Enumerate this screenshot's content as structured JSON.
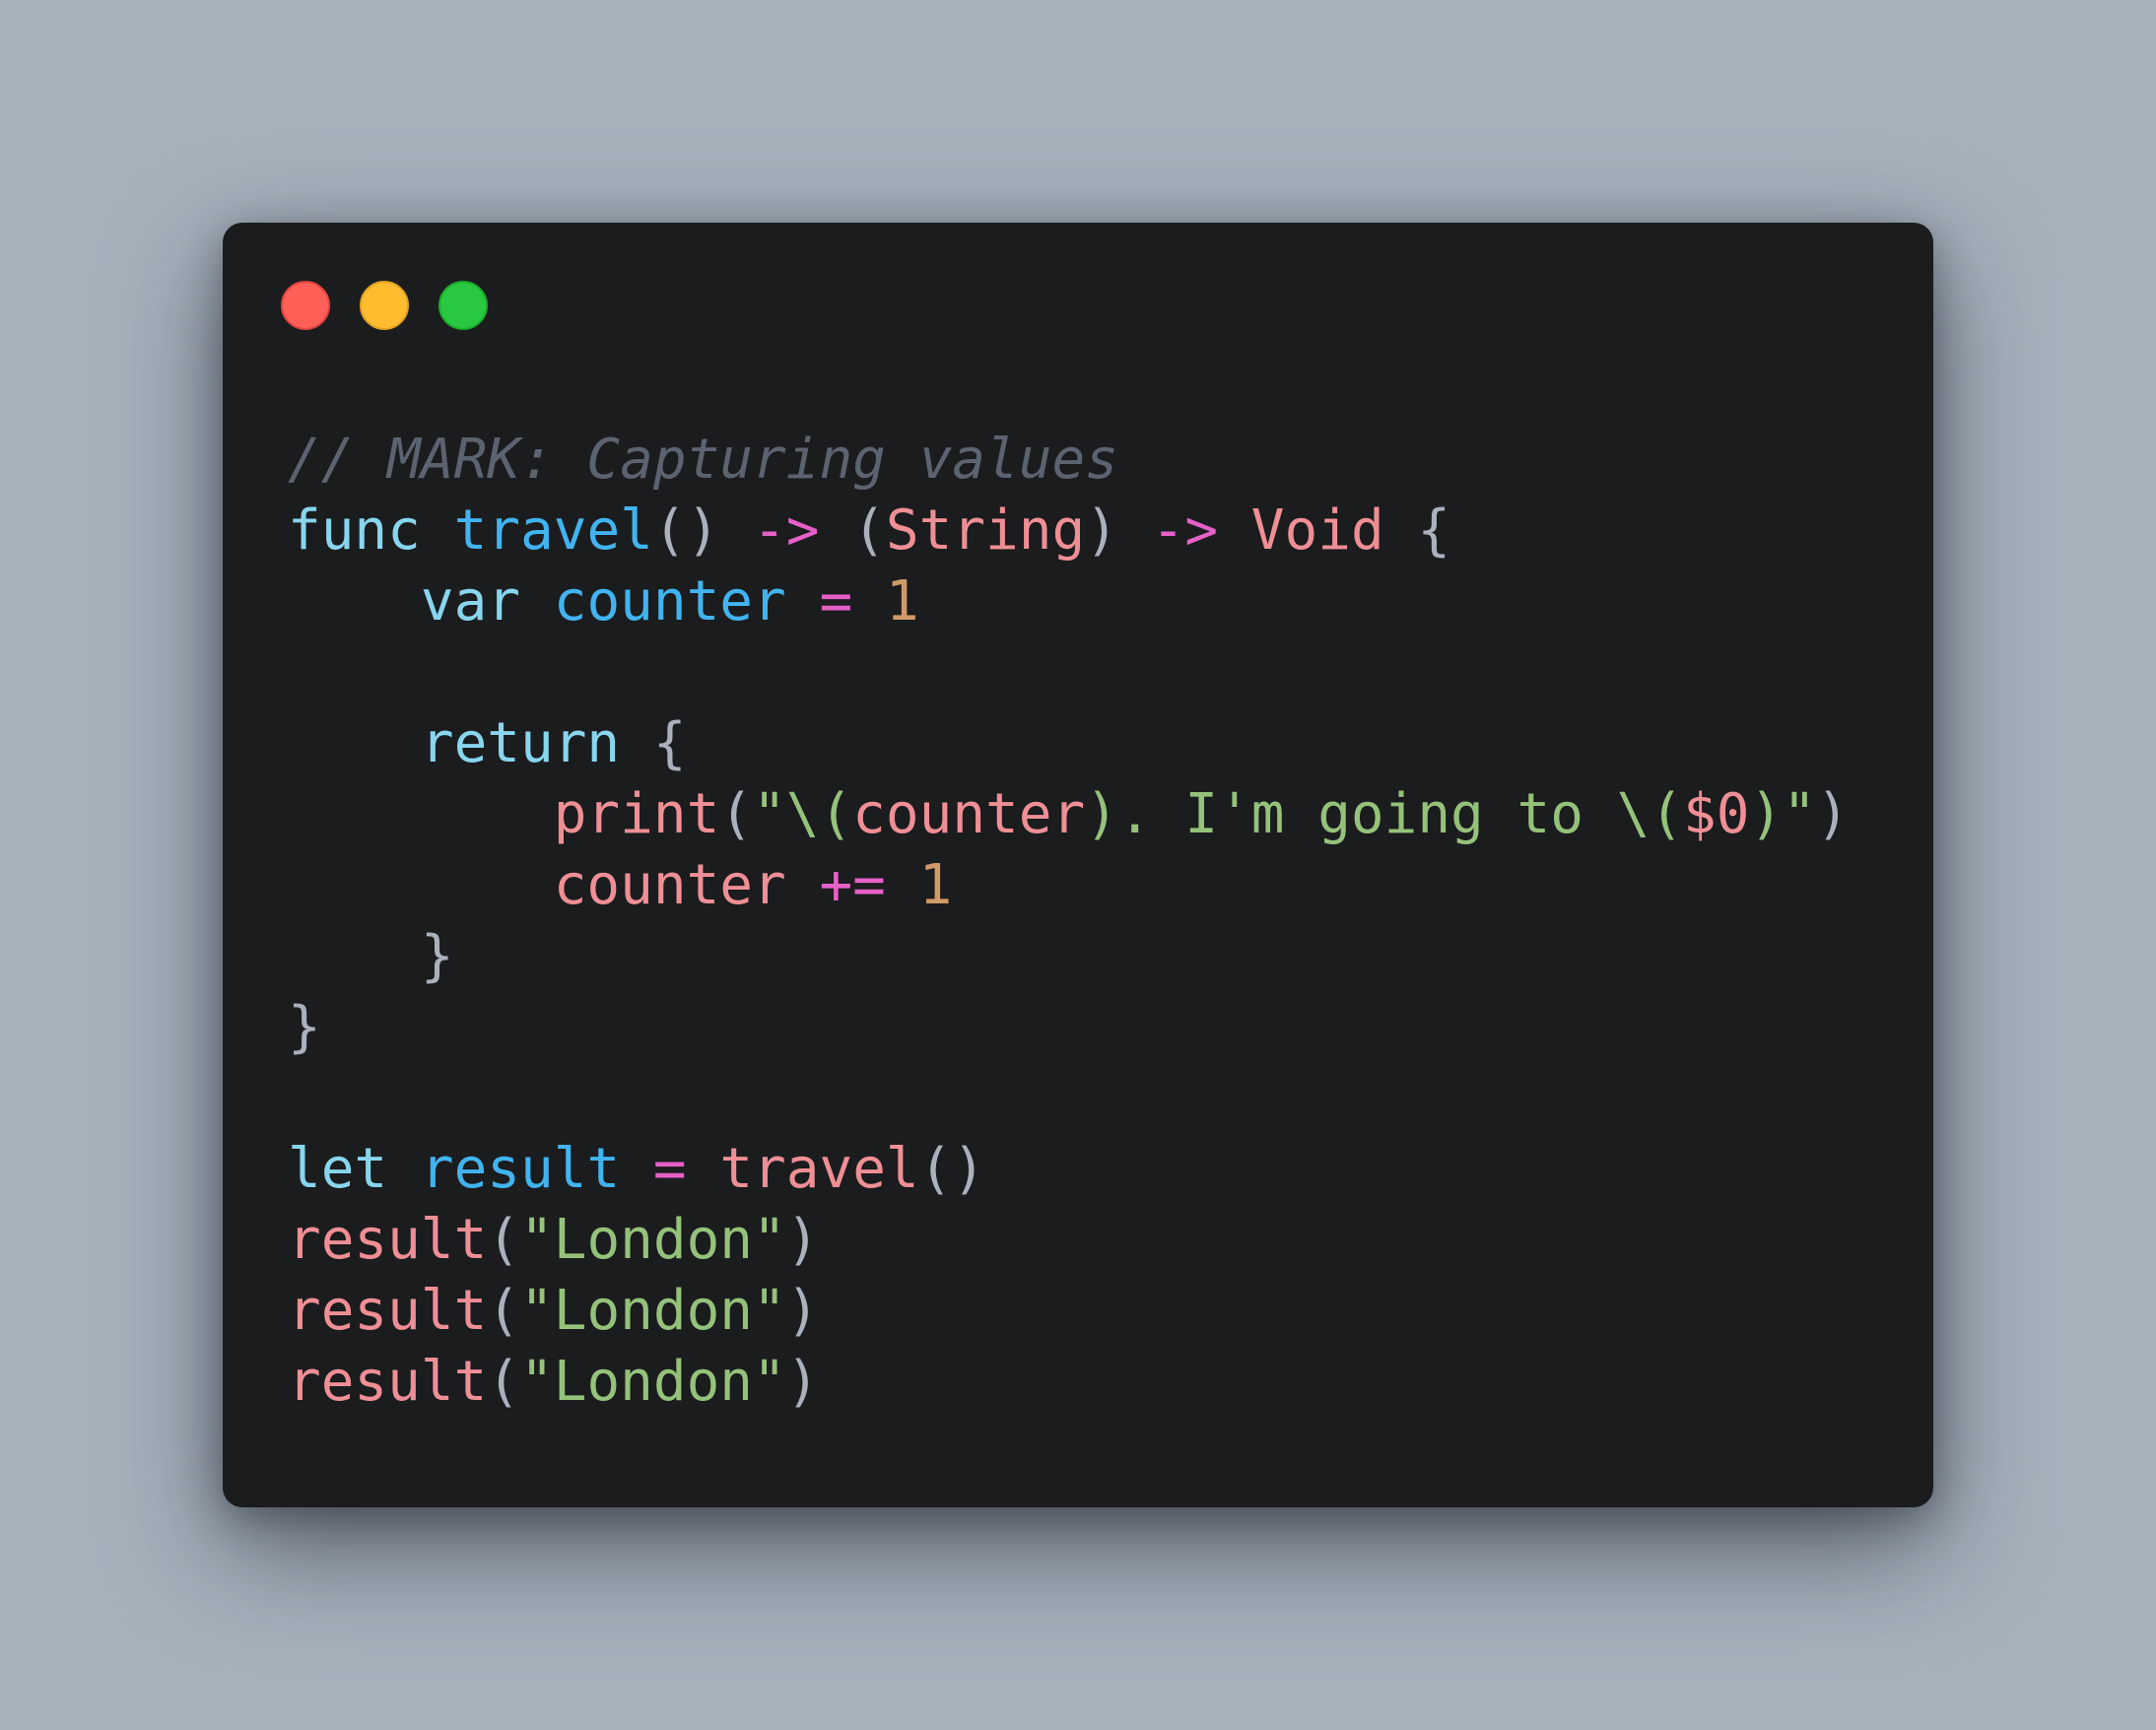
{
  "theme": {
    "background": "#a6b1bc",
    "window_background": "#1b1c1e",
    "colors": {
      "comment": "#5c6370",
      "keyword": "#88d5ee",
      "function": "#41b4f0",
      "type": "#ef8f95",
      "arrow": "#e660c8",
      "operator": "#e660c8",
      "number": "#cf9a68",
      "string": "#95c27a",
      "identifier": "#ef8f95",
      "punctuation": "#aab1bc"
    }
  },
  "window": {
    "traffic_lights": [
      {
        "name": "close",
        "color": "#fe5f57",
        "border": "#e0443e"
      },
      {
        "name": "minimize",
        "color": "#febc2e",
        "border": "#dea123"
      },
      {
        "name": "zoom",
        "color": "#28c840",
        "border": "#1aab29"
      }
    ]
  },
  "code": {
    "language": "Swift",
    "lines": [
      [
        {
          "t": "// MARK: Capturing values",
          "k": "comment"
        }
      ],
      [
        {
          "t": "func",
          "k": "keyword"
        },
        {
          "t": " ",
          "k": "punctuation"
        },
        {
          "t": "travel",
          "k": "function"
        },
        {
          "t": "() ",
          "k": "punctuation"
        },
        {
          "t": "->",
          "k": "arrow"
        },
        {
          "t": " (",
          "k": "punctuation"
        },
        {
          "t": "String",
          "k": "type"
        },
        {
          "t": ") ",
          "k": "punctuation"
        },
        {
          "t": "->",
          "k": "arrow"
        },
        {
          "t": " ",
          "k": "punctuation"
        },
        {
          "t": "Void",
          "k": "type"
        },
        {
          "t": " {",
          "k": "punctuation"
        }
      ],
      [
        {
          "t": "    ",
          "k": "punctuation"
        },
        {
          "t": "var",
          "k": "keyword"
        },
        {
          "t": " ",
          "k": "punctuation"
        },
        {
          "t": "counter",
          "k": "function"
        },
        {
          "t": " ",
          "k": "punctuation"
        },
        {
          "t": "=",
          "k": "operator"
        },
        {
          "t": " ",
          "k": "punctuation"
        },
        {
          "t": "1",
          "k": "number"
        }
      ],
      [],
      [
        {
          "t": "    ",
          "k": "punctuation"
        },
        {
          "t": "return",
          "k": "keyword"
        },
        {
          "t": " {",
          "k": "punctuation"
        }
      ],
      [
        {
          "t": "        ",
          "k": "punctuation"
        },
        {
          "t": "print",
          "k": "identifier"
        },
        {
          "t": "(",
          "k": "punctuation"
        },
        {
          "t": "\"\\(",
          "k": "string"
        },
        {
          "t": "counter",
          "k": "identifier"
        },
        {
          "t": "). I'm going to \\(",
          "k": "string"
        },
        {
          "t": "$0",
          "k": "identifier"
        },
        {
          "t": ")\"",
          "k": "string"
        },
        {
          "t": ")",
          "k": "punctuation"
        }
      ],
      [
        {
          "t": "        ",
          "k": "punctuation"
        },
        {
          "t": "counter",
          "k": "identifier"
        },
        {
          "t": " ",
          "k": "punctuation"
        },
        {
          "t": "+=",
          "k": "operator"
        },
        {
          "t": " ",
          "k": "punctuation"
        },
        {
          "t": "1",
          "k": "number"
        }
      ],
      [
        {
          "t": "    }",
          "k": "punctuation"
        }
      ],
      [
        {
          "t": "}",
          "k": "punctuation"
        }
      ],
      [],
      [
        {
          "t": "let",
          "k": "keyword"
        },
        {
          "t": " ",
          "k": "punctuation"
        },
        {
          "t": "result",
          "k": "function"
        },
        {
          "t": " ",
          "k": "punctuation"
        },
        {
          "t": "=",
          "k": "operator"
        },
        {
          "t": " ",
          "k": "punctuation"
        },
        {
          "t": "travel",
          "k": "identifier"
        },
        {
          "t": "()",
          "k": "punctuation"
        }
      ],
      [
        {
          "t": "result",
          "k": "identifier"
        },
        {
          "t": "(",
          "k": "punctuation"
        },
        {
          "t": "\"London\"",
          "k": "string"
        },
        {
          "t": ")",
          "k": "punctuation"
        }
      ],
      [
        {
          "t": "result",
          "k": "identifier"
        },
        {
          "t": "(",
          "k": "punctuation"
        },
        {
          "t": "\"London\"",
          "k": "string"
        },
        {
          "t": ")",
          "k": "punctuation"
        }
      ],
      [
        {
          "t": "result",
          "k": "identifier"
        },
        {
          "t": "(",
          "k": "punctuation"
        },
        {
          "t": "\"London\"",
          "k": "string"
        },
        {
          "t": ")",
          "k": "punctuation"
        }
      ]
    ]
  }
}
